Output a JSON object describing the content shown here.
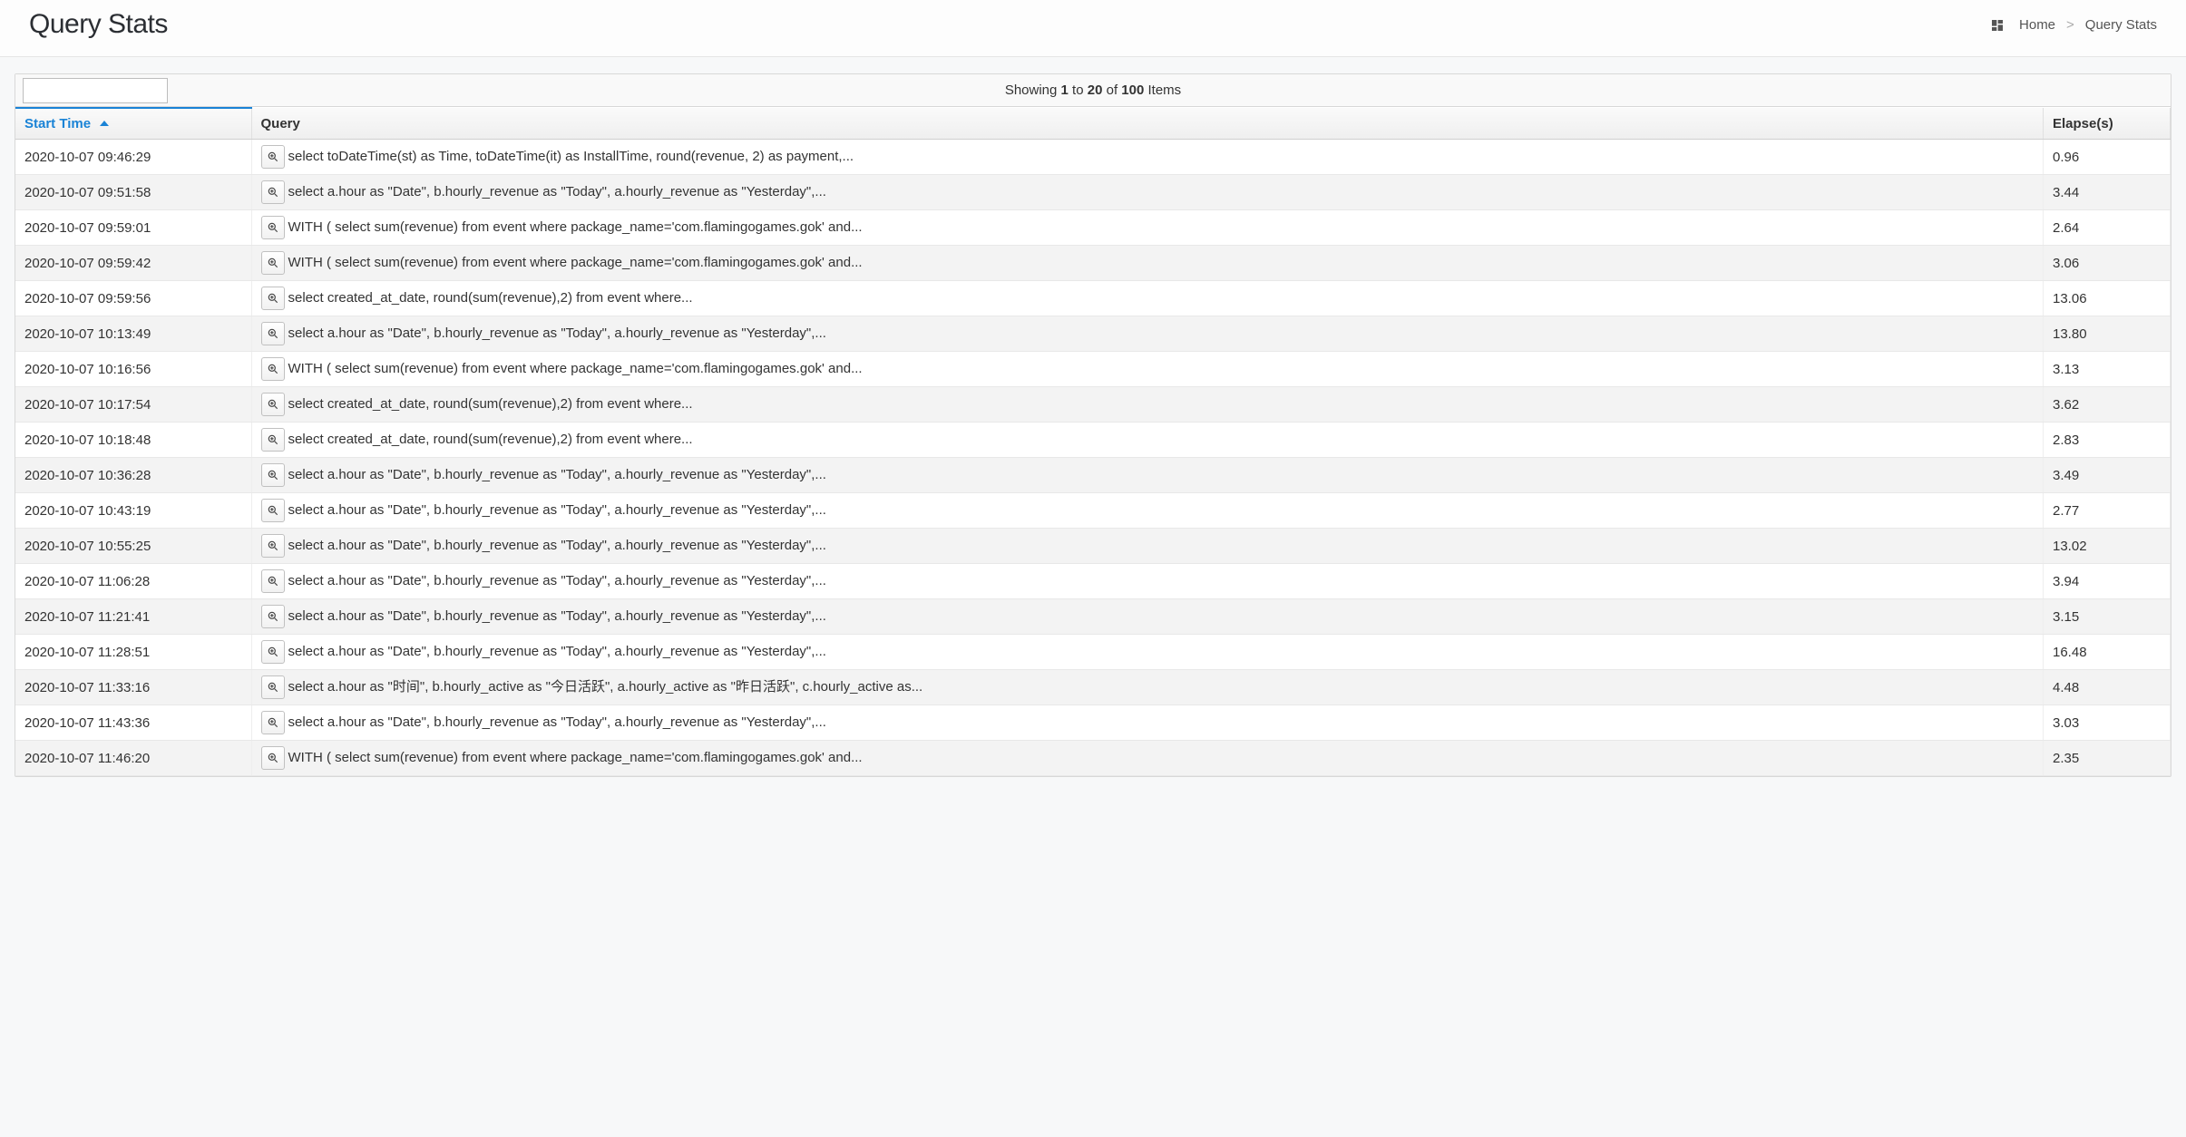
{
  "header": {
    "title": "Query Stats"
  },
  "breadcrumb": {
    "home": "Home",
    "sep": ">",
    "current": "Query Stats"
  },
  "pager": {
    "showing_pre": "Showing",
    "from": "1",
    "to_word": "to",
    "to": "20",
    "of_word": "of",
    "total": "100",
    "items_word": "Items"
  },
  "columns": {
    "start_time": "Start Time",
    "query": "Query",
    "elapse": "Elapse(s)"
  },
  "rows": [
    {
      "time": "2020-10-07 09:46:29",
      "query": "select toDateTime(st) as Time, toDateTime(it) as InstallTime, round(revenue, 2) as payment,...",
      "elapse": "0.96"
    },
    {
      "time": "2020-10-07 09:51:58",
      "query": "select a.hour as \"Date\", b.hourly_revenue as \"Today\", a.hourly_revenue as \"Yesterday\",...",
      "elapse": "3.44"
    },
    {
      "time": "2020-10-07 09:59:01",
      "query": "WITH ( select sum(revenue) from event where package_name='com.flamingogames.gok' and...",
      "elapse": "2.64"
    },
    {
      "time": "2020-10-07 09:59:42",
      "query": "WITH ( select sum(revenue) from event where package_name='com.flamingogames.gok' and...",
      "elapse": "3.06"
    },
    {
      "time": "2020-10-07 09:59:56",
      "query": "select created_at_date, round(sum(revenue),2) from event where...",
      "elapse": "13.06"
    },
    {
      "time": "2020-10-07 10:13:49",
      "query": "select a.hour as \"Date\", b.hourly_revenue as \"Today\", a.hourly_revenue as \"Yesterday\",...",
      "elapse": "13.80"
    },
    {
      "time": "2020-10-07 10:16:56",
      "query": "WITH ( select sum(revenue) from event where package_name='com.flamingogames.gok' and...",
      "elapse": "3.13"
    },
    {
      "time": "2020-10-07 10:17:54",
      "query": "select created_at_date, round(sum(revenue),2) from event where...",
      "elapse": "3.62"
    },
    {
      "time": "2020-10-07 10:18:48",
      "query": "select created_at_date, round(sum(revenue),2) from event where...",
      "elapse": "2.83"
    },
    {
      "time": "2020-10-07 10:36:28",
      "query": "select a.hour as \"Date\", b.hourly_revenue as \"Today\", a.hourly_revenue as \"Yesterday\",...",
      "elapse": "3.49"
    },
    {
      "time": "2020-10-07 10:43:19",
      "query": "select a.hour as \"Date\", b.hourly_revenue as \"Today\", a.hourly_revenue as \"Yesterday\",...",
      "elapse": "2.77"
    },
    {
      "time": "2020-10-07 10:55:25",
      "query": "select a.hour as \"Date\", b.hourly_revenue as \"Today\", a.hourly_revenue as \"Yesterday\",...",
      "elapse": "13.02"
    },
    {
      "time": "2020-10-07 11:06:28",
      "query": "select a.hour as \"Date\", b.hourly_revenue as \"Today\", a.hourly_revenue as \"Yesterday\",...",
      "elapse": "3.94"
    },
    {
      "time": "2020-10-07 11:21:41",
      "query": "select a.hour as \"Date\", b.hourly_revenue as \"Today\", a.hourly_revenue as \"Yesterday\",...",
      "elapse": "3.15"
    },
    {
      "time": "2020-10-07 11:28:51",
      "query": "select a.hour as \"Date\", b.hourly_revenue as \"Today\", a.hourly_revenue as \"Yesterday\",...",
      "elapse": "16.48"
    },
    {
      "time": "2020-10-07 11:33:16",
      "query": "select a.hour as \"时间\", b.hourly_active as \"今日活跃\", a.hourly_active as \"昨日活跃\", c.hourly_active as...",
      "elapse": "4.48"
    },
    {
      "time": "2020-10-07 11:43:36",
      "query": "select a.hour as \"Date\", b.hourly_revenue as \"Today\", a.hourly_revenue as \"Yesterday\",...",
      "elapse": "3.03"
    },
    {
      "time": "2020-10-07 11:46:20",
      "query": "WITH ( select sum(revenue) from event where package_name='com.flamingogames.gok' and...",
      "elapse": "2.35"
    }
  ]
}
